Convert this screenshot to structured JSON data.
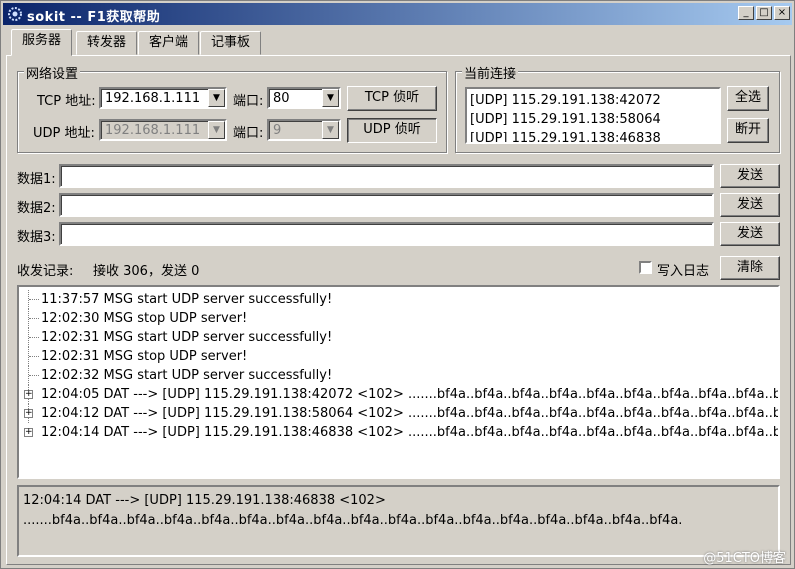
{
  "window": {
    "title": "sokit -- F1获取帮助",
    "minimize": "_",
    "maximize": "□",
    "close": "×"
  },
  "tabs": [
    {
      "label": "服务器",
      "active": true
    },
    {
      "label": "转发器"
    },
    {
      "label": "客户端"
    },
    {
      "label": "记事板"
    }
  ],
  "network": {
    "legend": "网络设置",
    "tcp_label": "TCP 地址:",
    "tcp_address": "192.168.1.111",
    "tcp_port_label": "端口:",
    "tcp_port": "80",
    "tcp_listen_button": "TCP 侦听",
    "udp_label": "UDP 地址:",
    "udp_address": "192.168.1.111",
    "udp_port_label": "端口:",
    "udp_port": "9",
    "udp_listen_button": "UDP 侦听"
  },
  "connections": {
    "legend": "当前连接",
    "items": [
      "[UDP] 115.29.191.138:42072",
      "[UDP] 115.29.191.138:58064",
      "[UDP] 115.29.191.138:46838"
    ],
    "select_all_button": "全选",
    "disconnect_button": "断开"
  },
  "data_rows": [
    {
      "label": "数据1:",
      "value": "",
      "send": "发送"
    },
    {
      "label": "数据2:",
      "value": "",
      "send": "发送"
    },
    {
      "label": "数据3:",
      "value": "",
      "send": "发送"
    }
  ],
  "log": {
    "label": "收发记录:",
    "stats": "接收 306，发送 0",
    "write_log_label": "写入日志",
    "write_log_checked": false,
    "clear_button": "清除",
    "entries": [
      {
        "text": "11:37:57 MSG start UDP server successfully!",
        "expandable": false
      },
      {
        "text": "12:02:30 MSG stop UDP server!",
        "expandable": false
      },
      {
        "text": "12:02:31 MSG start UDP server successfully!",
        "expandable": false
      },
      {
        "text": "12:02:31 MSG stop UDP server!",
        "expandable": false
      },
      {
        "text": "12:02:32 MSG start UDP server successfully!",
        "expandable": false
      },
      {
        "text": "12:04:05 DAT ---> [UDP] 115.29.191.138:42072 <102> .......bf4a..bf4a..bf4a..bf4a..bf4a..bf4a..bf4a..bf4a..bf4a..bf4a..b...",
        "expandable": true
      },
      {
        "text": "12:04:12 DAT ---> [UDP] 115.29.191.138:58064 <102> .......bf4a..bf4a..bf4a..bf4a..bf4a..bf4a..bf4a..bf4a..bf4a..bf4a..b...",
        "expandable": true
      },
      {
        "text": "12:04:14 DAT ---> [UDP] 115.29.191.138:46838 <102> .......bf4a..bf4a..bf4a..bf4a..bf4a..bf4a..bf4a..bf4a..bf4a..bf4a..b...",
        "expandable": true
      }
    ]
  },
  "detail": {
    "line1": "12:04:14 DAT ---> [UDP] 115.29.191.138:46838 <102>",
    "line2": ".......bf4a..bf4a..bf4a..bf4a..bf4a..bf4a..bf4a..bf4a..bf4a..bf4a..bf4a..bf4a..bf4a..bf4a..bf4a..bf4a..bf4a."
  },
  "watermark": "@51CTO博客",
  "icons": {
    "app": "gear-icon",
    "combo": "chevron-down-icon",
    "expand": "plus-icon"
  }
}
